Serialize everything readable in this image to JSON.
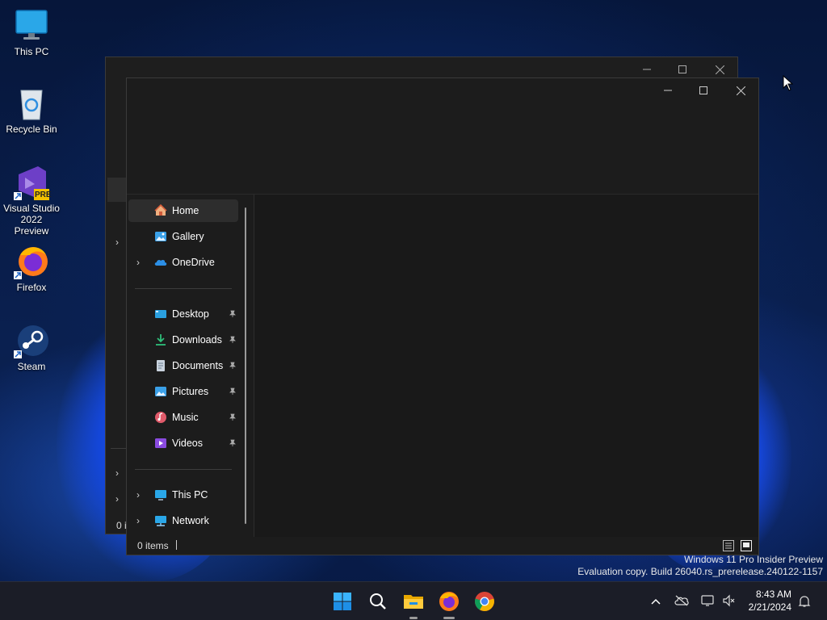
{
  "desktop": {
    "icons": [
      {
        "label": "This PC",
        "icon": "monitor-icon"
      },
      {
        "label": "Recycle Bin",
        "icon": "recycle-bin-icon"
      },
      {
        "label_line1": "Visual Studio",
        "label_line2": "2022 Preview",
        "badge": "PRE",
        "icon": "visual-studio-icon"
      },
      {
        "label": "Firefox",
        "icon": "firefox-icon"
      },
      {
        "label": "Steam",
        "icon": "steam-icon"
      }
    ]
  },
  "back_window": {
    "status_text": "0 i"
  },
  "explorer": {
    "nav": {
      "home": "Home",
      "gallery": "Gallery",
      "onedrive": "OneDrive",
      "desktop": "Desktop",
      "downloads": "Downloads",
      "documents": "Documents",
      "pictures": "Pictures",
      "music": "Music",
      "videos": "Videos",
      "this_pc": "This PC",
      "network": "Network"
    },
    "status": {
      "items": "0 items"
    }
  },
  "watermark": {
    "line1": "Windows 11 Pro Insider Preview",
    "line2": "Evaluation copy. Build 26040.rs_prerelease.240122-1157"
  },
  "taskbar": {
    "apps": [
      "start-icon",
      "search-icon",
      "file-explorer-icon",
      "firefox-icon",
      "chrome-icon"
    ],
    "clock": {
      "time": "8:43 AM",
      "date": "2/21/2024"
    }
  },
  "colors": {
    "window_bg": "#1c1c1c",
    "selected_nav": "#2d2d2d",
    "taskbar_bg": "#1b1d27"
  }
}
